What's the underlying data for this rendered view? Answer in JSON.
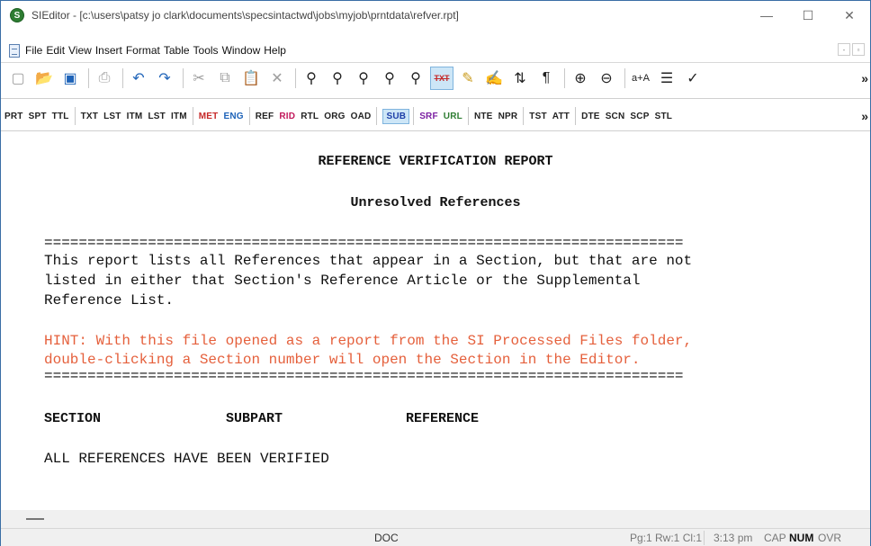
{
  "window": {
    "title": "SIEditor - [c:\\users\\patsy jo clark\\documents\\specsintactwd\\jobs\\myjob\\prntdata\\refver.rpt]",
    "app_icon_glyph": "S",
    "minimize_glyph": "—",
    "maximize_glyph": "☐",
    "close_glyph": "✕"
  },
  "menu": {
    "items": [
      "File",
      "Edit",
      "View",
      "Insert",
      "Format",
      "Table",
      "Tools",
      "Window",
      "Help"
    ]
  },
  "toolbar1": {
    "icons": [
      "new-document",
      "open-folder",
      "save",
      "print",
      "undo",
      "redo",
      "cut",
      "copy",
      "paste",
      "delete",
      "find",
      "find-next",
      "find-prev",
      "find-tag",
      "find-all",
      "txt-toggle",
      "track-changes",
      "publish",
      "txt-compare",
      "paragraph-marks",
      "zoom-in",
      "zoom-out",
      "case-change",
      "line-spacing",
      "spell-check"
    ],
    "txt_label": "TXT",
    "overflow": "»"
  },
  "toolbar2": {
    "tags": [
      {
        "label": "PRT",
        "color": "#222222"
      },
      {
        "label": "SPT",
        "color": "#222222"
      },
      {
        "label": "TTL",
        "color": "#222222"
      },
      {
        "label": "TXT",
        "color": "#222222"
      },
      {
        "label": "LST",
        "color": "#222222"
      },
      {
        "label": "ITM",
        "color": "#222222"
      },
      {
        "label": "LST",
        "color": "#222222"
      },
      {
        "label": "ITM",
        "color": "#222222"
      },
      {
        "label": "MET",
        "color": "#c62828"
      },
      {
        "label": "ENG",
        "color": "#1e63b8"
      },
      {
        "label": "REF",
        "color": "#222222"
      },
      {
        "label": "RID",
        "color": "#c2185b"
      },
      {
        "label": "RTL",
        "color": "#222222"
      },
      {
        "label": "ORG",
        "color": "#222222"
      },
      {
        "label": "OAD",
        "color": "#222222"
      },
      {
        "label": "SUB",
        "color": "#1e3fa8"
      },
      {
        "label": "SRF",
        "color": "#7b1fa2"
      },
      {
        "label": "URL",
        "color": "#2e7d32"
      },
      {
        "label": "NTE",
        "color": "#222222"
      },
      {
        "label": "NPR",
        "color": "#222222"
      },
      {
        "label": "TST",
        "color": "#222222"
      },
      {
        "label": "ATT",
        "color": "#222222"
      },
      {
        "label": "DTE",
        "color": "#222222"
      },
      {
        "label": "SCN",
        "color": "#222222"
      },
      {
        "label": "SCP",
        "color": "#222222"
      },
      {
        "label": "STL",
        "color": "#222222"
      }
    ],
    "active_tag": "SUB",
    "overflow": "»"
  },
  "report": {
    "title": "REFERENCE VERIFICATION REPORT",
    "subtitle": "Unresolved References",
    "separator": "==========================================================================",
    "intro_lines": [
      "This report lists all References that appear in a Section, but that are not",
      "listed in either that Section's Reference Article or the Supplemental",
      "Reference List."
    ],
    "hint_lines": [
      "HINT: With this file opened as a report from the SI Processed Files folder,",
      "double-clicking a Section number will open the Section in the Editor."
    ],
    "hint_color": "#e5603c",
    "columns": [
      "SECTION",
      "SUBPART",
      "REFERENCE"
    ],
    "result": "ALL REFERENCES HAVE BEEN VERIFIED"
  },
  "statusbar": {
    "mode": "DOC",
    "position": "Pg:1 Rw:1 Cl:1",
    "time": "3:13 pm",
    "cap": "CAP",
    "num": "NUM",
    "ovr": "OVR"
  }
}
